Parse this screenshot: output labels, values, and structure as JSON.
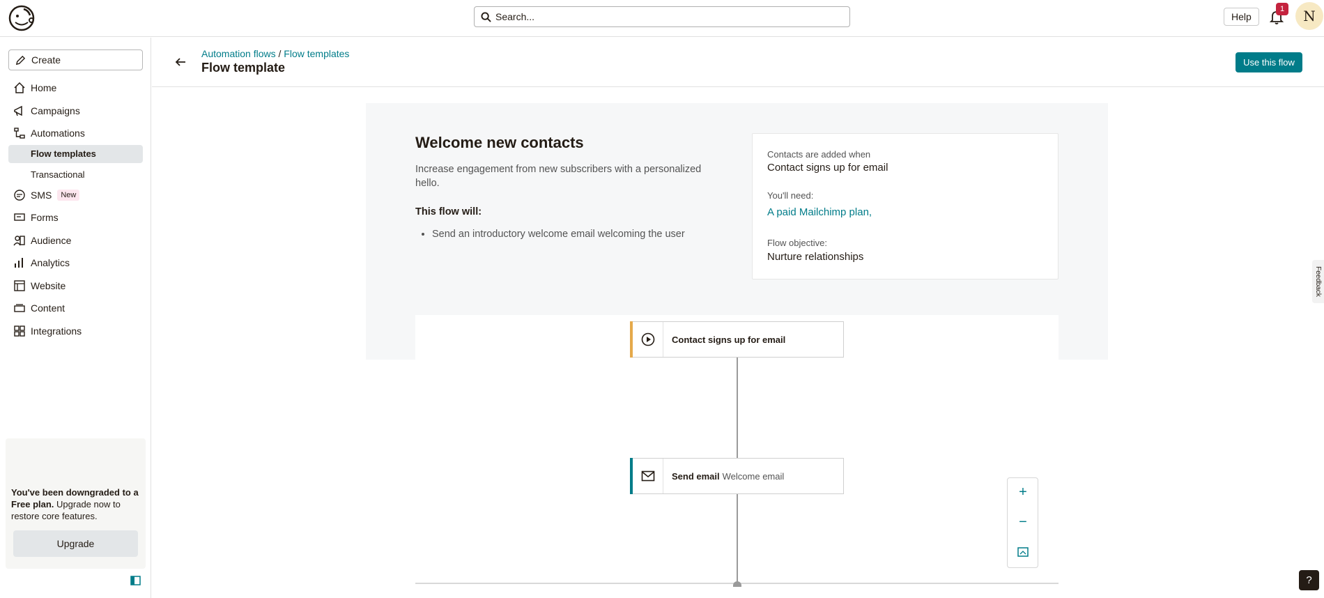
{
  "topbar": {
    "search_placeholder": "Search...",
    "help_label": "Help",
    "notification_count": "1",
    "avatar_initial": "N"
  },
  "sidebar": {
    "create_label": "Create",
    "items": [
      {
        "label": "Home",
        "icon": "home-icon"
      },
      {
        "label": "Campaigns",
        "icon": "megaphone-icon"
      },
      {
        "label": "Automations",
        "icon": "automations-icon"
      },
      {
        "label": "SMS",
        "icon": "sms-icon",
        "badge": "New"
      },
      {
        "label": "Forms",
        "icon": "forms-icon"
      },
      {
        "label": "Audience",
        "icon": "audience-icon"
      },
      {
        "label": "Analytics",
        "icon": "analytics-icon"
      },
      {
        "label": "Website",
        "icon": "website-icon"
      },
      {
        "label": "Content",
        "icon": "content-icon"
      },
      {
        "label": "Integrations",
        "icon": "integrations-icon"
      }
    ],
    "subitems": {
      "flow_templates": "Flow templates",
      "transactional": "Transactional"
    },
    "downgrade": {
      "bold": "You've been downgraded to a Free plan.",
      "rest": " Upgrade now to restore core features.",
      "button": "Upgrade"
    }
  },
  "header": {
    "breadcrumb_1": "Automation flows",
    "breadcrumb_sep": " / ",
    "breadcrumb_2": "Flow templates",
    "title": "Flow template",
    "use_flow_button": "Use this flow"
  },
  "flow": {
    "title": "Welcome new contacts",
    "description": "Increase engagement from new subscribers with a personalized hello.",
    "will_heading": "This flow will:",
    "will_items": [
      "Send an introductory welcome email welcoming the user"
    ]
  },
  "info": {
    "added_label": "Contacts are added when",
    "added_value": "Contact signs up for email",
    "need_label": "You'll need:",
    "need_link": "A paid Mailchimp plan",
    "need_suffix": ",",
    "objective_label": "Flow objective:",
    "objective_value": "Nurture relationships"
  },
  "canvas": {
    "trigger_label": "Contact signs up for email",
    "action_label": "Send email",
    "action_sub": "Welcome email",
    "zoom_in": "+",
    "zoom_out": "−"
  },
  "misc": {
    "feedback": "Feedback",
    "help_question": "?"
  },
  "colors": {
    "brand_teal": "#007c89",
    "trigger_stripe": "#e5a94b",
    "action_stripe": "#007c89",
    "alert_red": "#c4233e"
  }
}
